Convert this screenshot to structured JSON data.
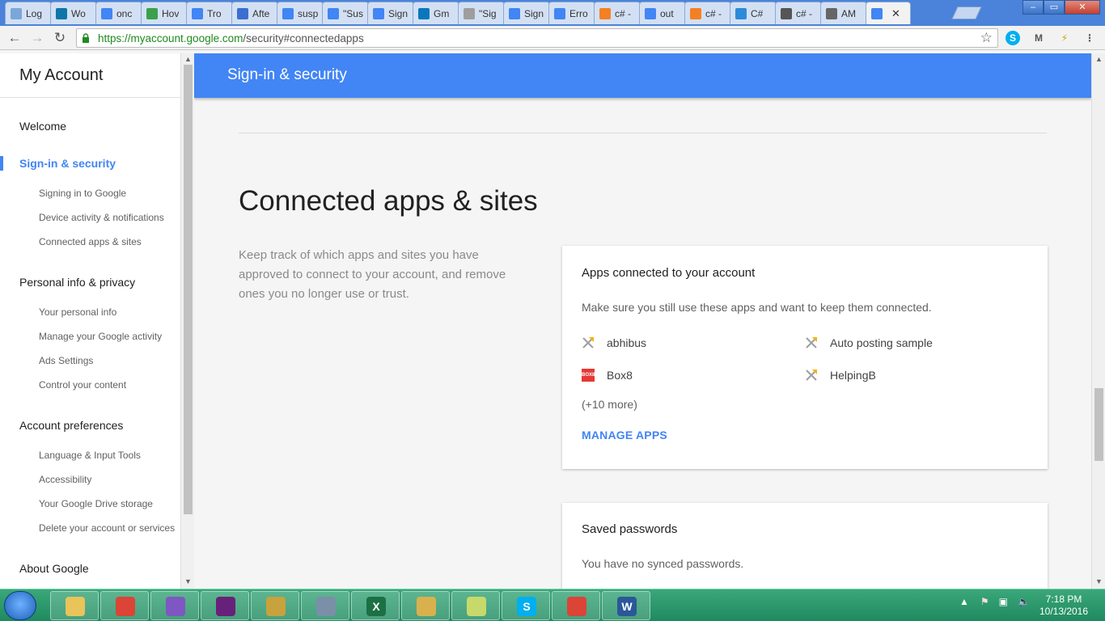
{
  "browser": {
    "tabs": [
      {
        "title": "Log",
        "icon": "gear-icon",
        "color": "#7aa7d8"
      },
      {
        "title": "Wo",
        "icon": "linkedin-icon",
        "color": "#0e76a8"
      },
      {
        "title": "onc",
        "icon": "google-icon",
        "color": "#4285f4"
      },
      {
        "title": "Hov",
        "icon": "app-icon",
        "color": "#3aa14a"
      },
      {
        "title": "Tro",
        "icon": "google-icon",
        "color": "#4285f4"
      },
      {
        "title": "Afte",
        "icon": "doc-icon",
        "color": "#3b6fcf"
      },
      {
        "title": "susp",
        "icon": "google-icon",
        "color": "#4285f4"
      },
      {
        "title": "\"Sus",
        "icon": "google-icon",
        "color": "#4285f4"
      },
      {
        "title": "Sign",
        "icon": "google-icon",
        "color": "#4285f4"
      },
      {
        "title": "Gm",
        "icon": "drupal-icon",
        "color": "#0a77bd"
      },
      {
        "title": "\"Sig",
        "icon": "page-icon",
        "color": "#9e9e9e"
      },
      {
        "title": "Sign",
        "icon": "google-icon",
        "color": "#4285f4"
      },
      {
        "title": "Erro",
        "icon": "google-icon",
        "color": "#4285f4"
      },
      {
        "title": "c# -",
        "icon": "stackoverflow-icon",
        "color": "#f48024"
      },
      {
        "title": "out",
        "icon": "google-icon",
        "color": "#4285f4"
      },
      {
        "title": "c# -",
        "icon": "stackoverflow-icon",
        "color": "#f48024"
      },
      {
        "title": "C#",
        "icon": "csharp-icon",
        "color": "#2e8bd8"
      },
      {
        "title": "c# -",
        "icon": "globe-icon",
        "color": "#555555"
      },
      {
        "title": "AM",
        "icon": "m-icon",
        "color": "#666666"
      },
      {
        "title": "",
        "icon": "google-icon",
        "color": "#4285f4",
        "active": true
      }
    ],
    "url_host": "https://myaccount.google.com",
    "url_path": "/security#connectedapps",
    "close_glyph": "✕"
  },
  "sidebar": {
    "title": "My Account",
    "welcome": "Welcome",
    "sections": [
      {
        "label": "Sign-in & security",
        "active": true,
        "items": [
          "Signing in to Google",
          "Device activity & notifications",
          "Connected apps & sites"
        ]
      },
      {
        "label": "Personal info & privacy",
        "items": [
          "Your personal info",
          "Manage your Google activity",
          "Ads Settings",
          "Control your content"
        ]
      },
      {
        "label": "Account preferences",
        "items": [
          "Language & Input Tools",
          "Accessibility",
          "Your Google Drive storage",
          "Delete your account or services"
        ]
      }
    ],
    "about": "About Google"
  },
  "main": {
    "banner_title": "Sign-in & security",
    "heading": "Connected apps & sites",
    "description": "Keep track of which apps and sites you have approved to connect to your account, and remove ones you no longer use or trust.",
    "apps_card": {
      "title": "Apps connected to your account",
      "subtitle": "Make sure you still use these apps and want to keep them connected.",
      "apps": [
        {
          "name": "abhibus",
          "icon": "app-generic-icon"
        },
        {
          "name": "Auto posting sample",
          "icon": "app-generic-icon"
        },
        {
          "name": "Box8",
          "icon": "box8-icon"
        },
        {
          "name": "HelpingB",
          "icon": "app-generic-icon"
        }
      ],
      "more": "(+10 more)",
      "manage": "MANAGE APPS"
    },
    "passwords_card": {
      "title": "Saved passwords",
      "subtitle": "You have no synced passwords."
    }
  },
  "taskbar": {
    "time": "7:18 PM",
    "date": "10/13/2016",
    "apps": [
      {
        "name": "explorer",
        "color": "#e8c45a"
      },
      {
        "name": "chrome",
        "color": "#db4437"
      },
      {
        "name": "github",
        "color": "#7e57c2"
      },
      {
        "name": "visual-studio",
        "color": "#68217a"
      },
      {
        "name": "tools",
        "color": "#c8a23c"
      },
      {
        "name": "server",
        "color": "#7a8fa8"
      },
      {
        "name": "excel",
        "color": "#1d7044",
        "label": "X"
      },
      {
        "name": "remote",
        "color": "#d9b14c"
      },
      {
        "name": "notes",
        "color": "#c7d96b"
      },
      {
        "name": "skype",
        "color": "#00aff0",
        "label": "S"
      },
      {
        "name": "chrome",
        "color": "#db4437"
      },
      {
        "name": "word",
        "color": "#2b579a",
        "label": "W"
      }
    ]
  }
}
